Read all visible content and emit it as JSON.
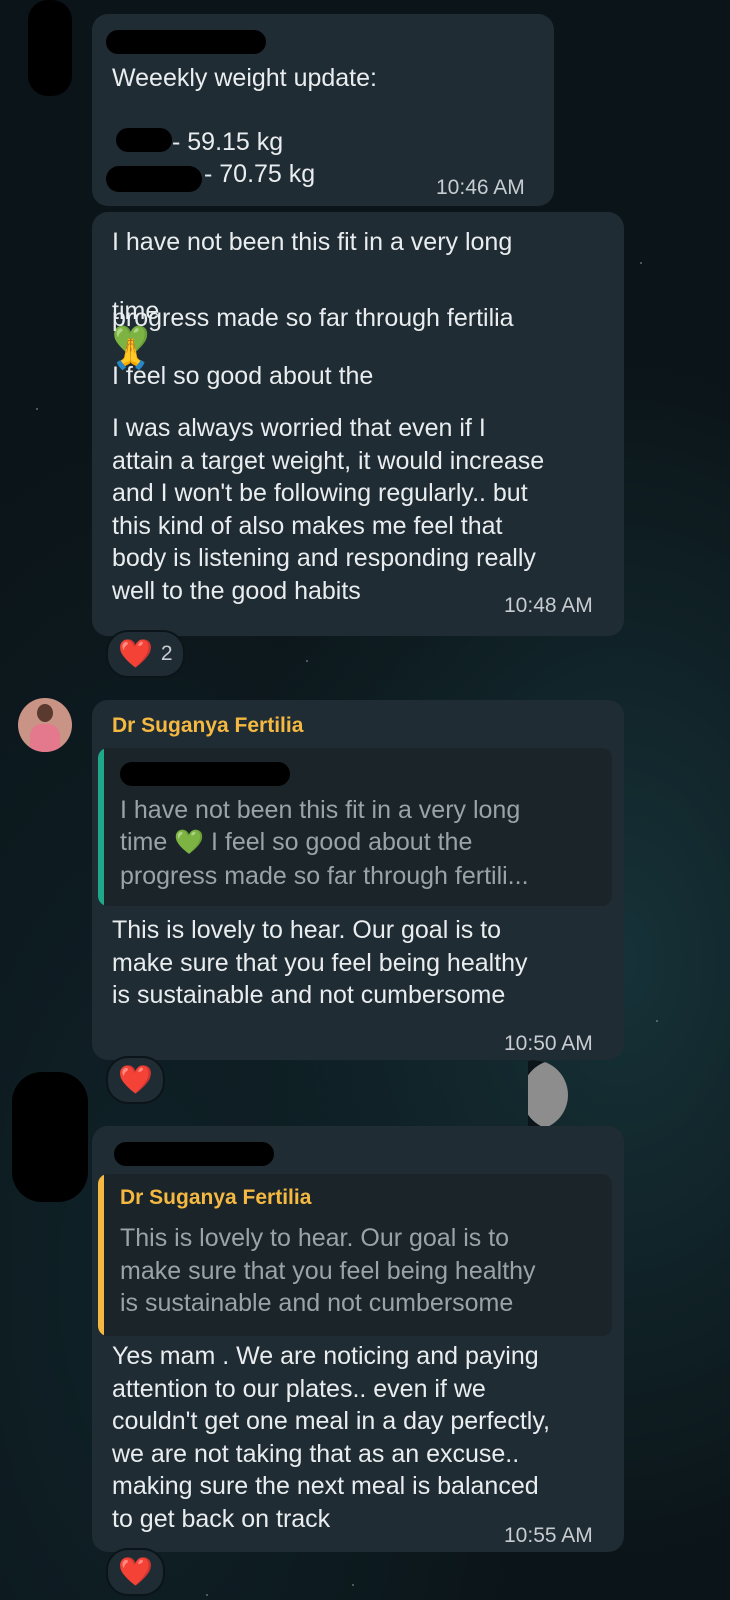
{
  "messages": {
    "m1": {
      "title": "Weeekly weight update:",
      "line1": "- 59.15 kg",
      "line2": "- 70.75 kg",
      "time": "10:46 AM"
    },
    "m2": {
      "part1": "I have not been this fit in a very long",
      "part2_a": "time",
      "part2_b": "I feel so good about the",
      "part3": "progress made so far through fertilia",
      "body": "I was always worried that even if I\nattain a target weight, it would increase\nand I won't be following regularly.. but\nthis kind of also makes me feel that\nbody is listening and responding really\nwell to the good habits",
      "time": "10:48 AM",
      "reaction_count": "2"
    },
    "m3": {
      "sender": "Dr Suganya Fertilia",
      "quote_line1": "I have not been this fit in a very long",
      "quote_line2_a": "time",
      "quote_line2_b": "I feel so good about the",
      "quote_line3": "progress made so far through fertili...",
      "body": "This is lovely to hear. Our goal is to\nmake sure that you feel being healthy\nis sustainable and not cumbersome",
      "time": "10:50 AM"
    },
    "m4": {
      "quote_sender": "Dr Suganya Fertilia",
      "quote_text": "This is lovely to hear. Our goal is to\nmake sure that you feel being healthy\nis sustainable and not cumbersome",
      "body": "Yes mam . We are noticing and paying\nattention to our plates.. even if we\ncouldn't get one meal in a day perfectly,\nwe are not taking that as an excuse..\nmaking sure the next meal is balanced\nto get back on track",
      "time": "10:55 AM"
    }
  },
  "icons": {
    "green_heart": "💚",
    "pray": "🙏",
    "red_heart": "❤️"
  },
  "colors": {
    "bubble": "#202c33",
    "sender_name": "#f5b942",
    "quote_bar_teal": "#1fa88a",
    "quote_bar_yellow": "#f5b942",
    "reaction_heart": "#e8394a"
  }
}
